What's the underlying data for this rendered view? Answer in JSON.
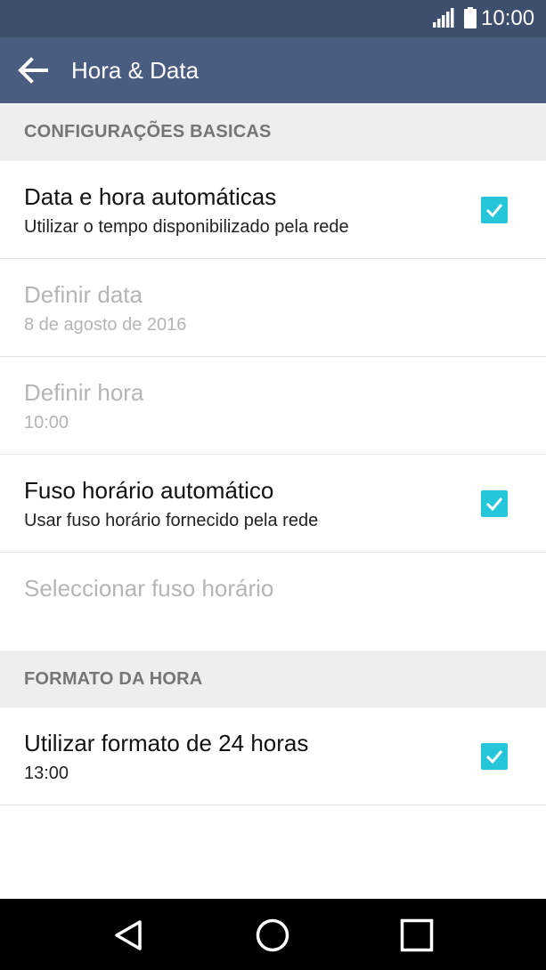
{
  "status_bar": {
    "time": "10:00",
    "icons": [
      "signal-icon",
      "battery-icon"
    ]
  },
  "app_bar": {
    "title": "Hora & Data",
    "back_icon": "arrow-left-icon"
  },
  "sections": [
    {
      "header": "CONFIGURAÇÕES BASICAS",
      "items": [
        {
          "title": "Data e hora automáticas",
          "subtitle": "Utilizar o tempo disponibilizado pela rede",
          "checked": true,
          "enabled": true
        },
        {
          "title": "Definir data",
          "subtitle": "8 de agosto de 2016",
          "enabled": false
        },
        {
          "title": "Definir hora",
          "subtitle": "10:00",
          "enabled": false
        },
        {
          "title": "Fuso horário automático",
          "subtitle": "Usar fuso horário fornecido pela rede",
          "checked": true,
          "enabled": true
        },
        {
          "title": "Seleccionar fuso horário",
          "enabled": false
        }
      ]
    },
    {
      "header": "FORMATO DA HORA",
      "items": [
        {
          "title": "Utilizar formato de 24 horas",
          "subtitle": "13:00",
          "checked": true,
          "enabled": true
        }
      ]
    }
  ],
  "nav_bar": {
    "icons": [
      "back-triangle-icon",
      "home-circle-icon",
      "recents-square-icon"
    ]
  },
  "colors": {
    "status_bar": "#3d4f6c",
    "app_bar": "#4a5d80",
    "checkbox": "#26c6da",
    "section_header_bg": "#eeeeee",
    "disabled_text": "#b5b5b5"
  }
}
